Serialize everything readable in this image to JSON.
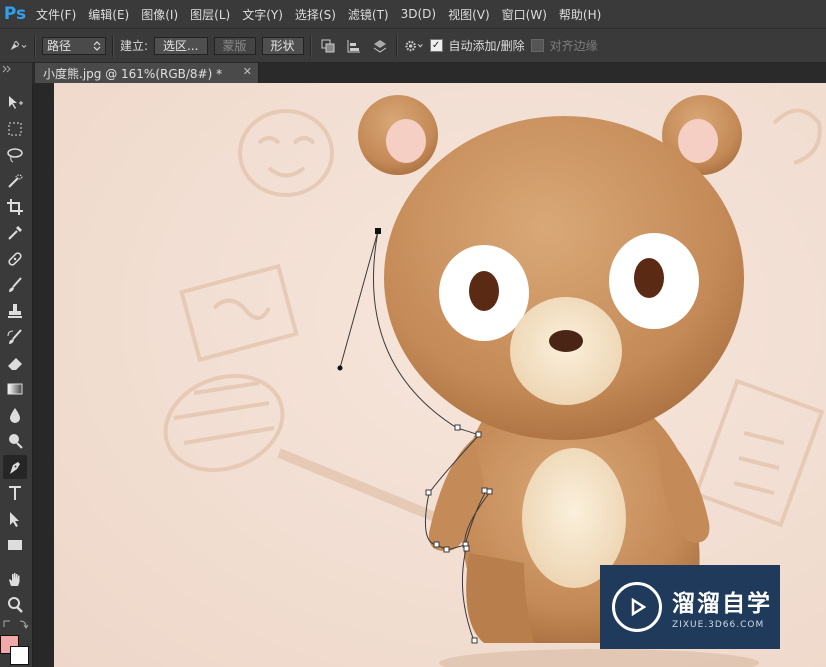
{
  "app": {
    "logo": "Ps"
  },
  "menu": [
    "文件(F)",
    "编辑(E)",
    "图像(I)",
    "图层(L)",
    "文字(Y)",
    "选择(S)",
    "滤镜(T)",
    "3D(D)",
    "视图(V)",
    "窗口(W)",
    "帮助(H)"
  ],
  "options": {
    "mode_value": "路径",
    "make_label": "建立:",
    "selection_button": "选区...",
    "mask_button": "蒙版",
    "shape_button": "形状",
    "auto_add_delete": "自动添加/删除",
    "align_edges": "对齐边缘"
  },
  "document": {
    "tab_title": "小度熊.jpg @ 161%(RGB/8#) *"
  },
  "watermark": {
    "title": "溜溜自学",
    "url": "ZIXUE.3D66.COM"
  },
  "colors": {
    "accent": "#2fa0f0",
    "foreground_swatch": "#f0a8a8",
    "background_swatch": "#ffffff"
  }
}
